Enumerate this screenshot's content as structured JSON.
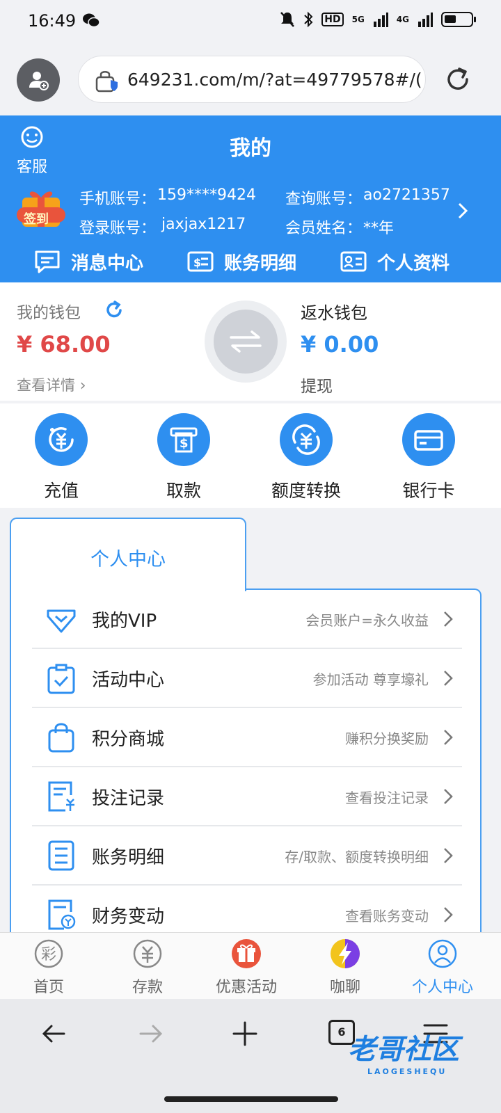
{
  "status_bar": {
    "time": "16:49",
    "network": "5G",
    "network2": "4G",
    "hd": "HD"
  },
  "browser": {
    "url": "649231.com/m/?at=49779578#/("
  },
  "header": {
    "title": "我的",
    "kefu_label": "客服",
    "signin_badge": "签到",
    "phone_label": "手机账号：",
    "phone_value": "159****9424",
    "query_label": "查询账号：",
    "query_value": "ao2721357",
    "login_label": "登录账号：",
    "login_value": "jaxjax1217",
    "member_label": "会员姓名：",
    "member_value": "**年",
    "quick_links": [
      "消息中心",
      "账务明细",
      "个人资料"
    ]
  },
  "wallet": {
    "my_wallet_label": "我的钱包",
    "my_wallet_amount": "¥ 68.00",
    "view_detail": "查看详情",
    "rebate_label": "返水钱包",
    "rebate_amount": "¥ 0.00",
    "withdraw_label": "提现"
  },
  "actions": [
    "充值",
    "取款",
    "额度转换",
    "银行卡"
  ],
  "personal_center": {
    "tab_label": "个人中心",
    "rows": [
      {
        "title": "我的VIP",
        "subtitle": "会员账户=永久收益",
        "icon": "vip-diamond-icon"
      },
      {
        "title": "活动中心",
        "subtitle": "参加活动 尊享壕礼",
        "icon": "activity-clipboard-icon"
      },
      {
        "title": "积分商城",
        "subtitle": "赚积分换奖励",
        "icon": "shopping-bag-icon"
      },
      {
        "title": "投注记录",
        "subtitle": "查看投注记录",
        "icon": "bet-record-icon"
      },
      {
        "title": "账务明细",
        "subtitle": "存/取款、额度转换明细",
        "icon": "ledger-icon"
      },
      {
        "title": "财务变动",
        "subtitle": "查看账务变动",
        "icon": "finance-change-icon"
      }
    ]
  },
  "bottom_nav": [
    {
      "label": "首页",
      "icon": "lottery-home-icon"
    },
    {
      "label": "存款",
      "icon": "deposit-yen-icon"
    },
    {
      "label": "优惠活动",
      "icon": "gift-icon"
    },
    {
      "label": "咖聊",
      "icon": "lightning-chat-icon"
    },
    {
      "label": "个人中心",
      "icon": "user-icon",
      "active": true
    }
  ],
  "browser_bar": {
    "tab_count": "6"
  },
  "watermark": {
    "text": "老哥社区",
    "sub": "LAOGESHEQU"
  },
  "colors": {
    "primary": "#2e8ff0",
    "wallet_red": "#e04848",
    "background": "#f1f2f5"
  }
}
